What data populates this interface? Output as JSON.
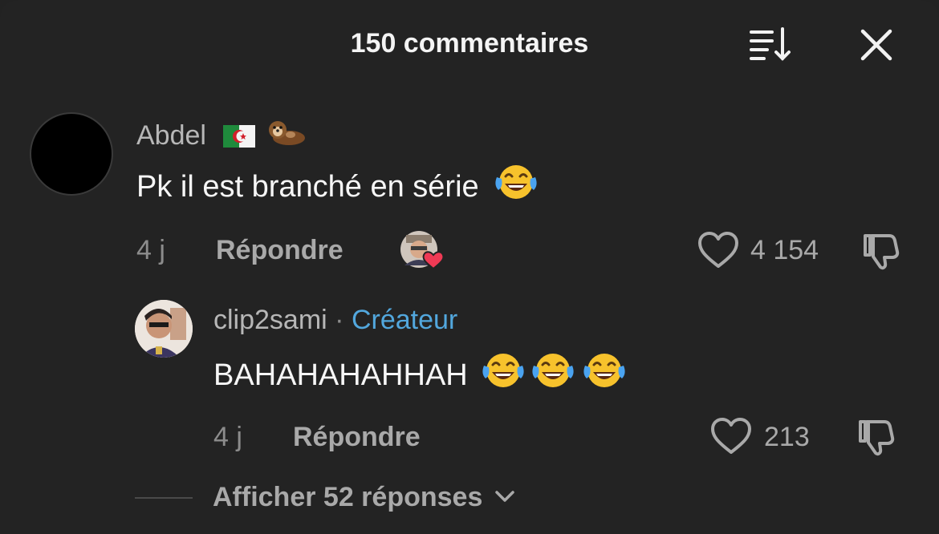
{
  "header": {
    "title": "150 commentaires",
    "sort_icon": "sort-descending-icon",
    "close_icon": "close-icon"
  },
  "comments": [
    {
      "username": "Abdel",
      "username_emojis": [
        "algeria-flag-emoji",
        "otter-emoji"
      ],
      "text": "Pk il est branché en série",
      "text_emojis": [
        "tears-of-joy-emoji"
      ],
      "time": "4 j",
      "reply_label": "Répondre",
      "creator_liked": true,
      "like_count": "4 154"
    },
    {
      "username": "clip2sami",
      "separator": "·",
      "badge": "Créateur",
      "text": "BAHAHAHAHHAH",
      "text_emojis": [
        "tears-of-joy-emoji",
        "tears-of-joy-emoji",
        "tears-of-joy-emoji"
      ],
      "time": "4 j",
      "reply_label": "Répondre",
      "like_count": "213"
    }
  ],
  "show_replies": {
    "label": "Afficher 52 réponses"
  },
  "colors": {
    "background": "#232323",
    "creator_badge": "#52a7dd",
    "heart": "#ef3a55",
    "emoji_face": "#f7c22c"
  }
}
